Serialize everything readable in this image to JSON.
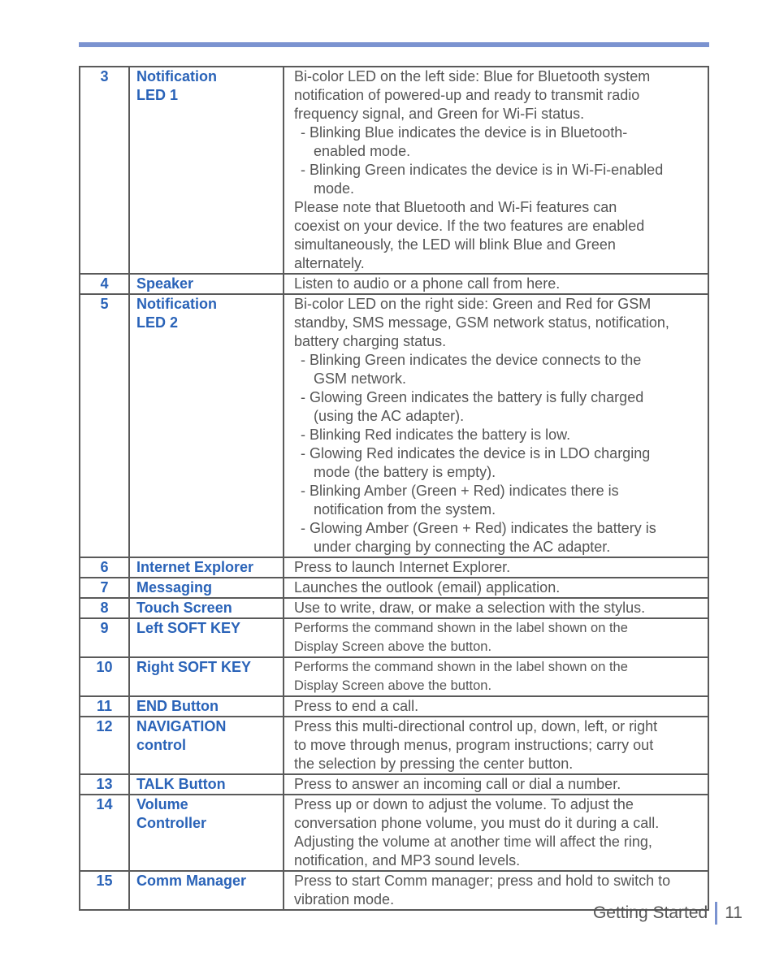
{
  "colors": {
    "accent_bar": "#7b93d0",
    "item_label": "#2a63b8",
    "body_text": "#555555",
    "border": "#5a5a5a"
  },
  "rows": [
    {
      "num": "3",
      "name": [
        "Notification",
        "LED 1"
      ],
      "desc": [
        {
          "t": "line",
          "text": "Bi-color LED on the left side: Blue for Bluetooth system"
        },
        {
          "t": "line",
          "text": "notification of powered-up and ready to transmit radio"
        },
        {
          "t": "line",
          "text": "frequency signal, and Green for Wi-Fi status."
        },
        {
          "t": "bullet",
          "text": "- Blinking Blue indicates the device is in Bluetooth-"
        },
        {
          "t": "cont",
          "text": "enabled mode."
        },
        {
          "t": "bullet",
          "text": "- Blinking Green indicates the device is in Wi-Fi-enabled"
        },
        {
          "t": "cont",
          "text": "mode."
        },
        {
          "t": "line",
          "text": "Please note that Bluetooth and Wi-Fi features can"
        },
        {
          "t": "line",
          "text": "coexist on your device. If the two features are enabled"
        },
        {
          "t": "line",
          "text": "simultaneously, the LED will blink Blue and Green"
        },
        {
          "t": "line",
          "text": "alternately."
        }
      ]
    },
    {
      "num": "4",
      "name": [
        "Speaker"
      ],
      "desc": [
        {
          "t": "line",
          "text": "Listen to audio or a phone call from here."
        }
      ]
    },
    {
      "num": "5",
      "name": [
        "Notification",
        "LED 2"
      ],
      "desc": [
        {
          "t": "line",
          "text": "Bi-color LED on the right side: Green and Red for GSM"
        },
        {
          "t": "line",
          "text": "standby, SMS message, GSM network status, notification,"
        },
        {
          "t": "line",
          "text": "battery charging status."
        },
        {
          "t": "bullet",
          "text": "-  Blinking Green indicates the device connects to the"
        },
        {
          "t": "cont",
          "text": "GSM network."
        },
        {
          "t": "bullet",
          "text": "-  Glowing Green indicates the battery is fully charged"
        },
        {
          "t": "cont",
          "text": "(using the AC adapter)."
        },
        {
          "t": "bullet",
          "text": "-  Blinking Red indicates the battery is low."
        },
        {
          "t": "bullet",
          "text": "-  Glowing Red indicates the device is in LDO charging"
        },
        {
          "t": "cont",
          "text": "mode (the battery is empty)."
        },
        {
          "t": "bullet",
          "text": "-  Blinking Amber (Green + Red) indicates there is"
        },
        {
          "t": "cont",
          "text": "notification from the system."
        },
        {
          "t": "bullet",
          "text": "-  Glowing Amber (Green + Red) indicates the battery is"
        },
        {
          "t": "cont",
          "text": "under charging by connecting the AC adapter."
        }
      ]
    },
    {
      "num": "6",
      "name": [
        "Internet Explorer"
      ],
      "desc": [
        {
          "t": "line",
          "text": "Press to launch Internet Explorer."
        }
      ]
    },
    {
      "num": "7",
      "name": [
        "Messaging"
      ],
      "desc": [
        {
          "t": "line",
          "text": "Launches the outlook (email) application."
        }
      ]
    },
    {
      "num": "8",
      "name": [
        "Touch Screen"
      ],
      "desc": [
        {
          "t": "line",
          "text": "Use to write, draw, or make a selection with the stylus."
        }
      ]
    },
    {
      "num": "9",
      "name": [
        "Left SOFT KEY"
      ],
      "small": true,
      "desc": [
        {
          "t": "line",
          "text": "Performs the command shown in the label shown on the"
        },
        {
          "t": "line",
          "text": "Display Screen above the button."
        }
      ]
    },
    {
      "num": "10",
      "name": [
        "Right SOFT KEY"
      ],
      "small": true,
      "desc": [
        {
          "t": "line",
          "text": "Performs the command shown in the label shown on the"
        },
        {
          "t": "line",
          "text": "Display Screen above the button."
        }
      ]
    },
    {
      "num": "11",
      "name": [
        "END Button"
      ],
      "desc": [
        {
          "t": "line",
          "text": "Press to end a call."
        }
      ]
    },
    {
      "num": "12",
      "name": [
        "NAVIGATION",
        "control"
      ],
      "desc": [
        {
          "t": "line",
          "text": "Press this multi-directional control up, down, left, or right"
        },
        {
          "t": "line",
          "text": "to move through menus, program instructions; carry out"
        },
        {
          "t": "line",
          "text": "the selection by pressing the center button."
        }
      ]
    },
    {
      "num": "13",
      "name": [
        "TALK Button"
      ],
      "desc": [
        {
          "t": "line",
          "text": "Press to answer an incoming call or dial a number."
        }
      ]
    },
    {
      "num": "14",
      "name": [
        "Volume",
        "Controller"
      ],
      "desc": [
        {
          "t": "line",
          "text": "Press up or down to adjust the volume. To adjust the"
        },
        {
          "t": "line",
          "text": "conversation phone volume, you must do it during a call."
        },
        {
          "t": "line",
          "text": "Adjusting the volume at another time will affect the ring,"
        },
        {
          "t": "line",
          "text": "notification, and MP3 sound levels."
        }
      ]
    },
    {
      "num": "15",
      "name": [
        "Comm Manager"
      ],
      "desc": [
        {
          "t": "line",
          "text": "Press to start Comm manager; press and hold to switch to"
        },
        {
          "t": "line",
          "text": "vibration mode."
        }
      ]
    }
  ],
  "footer": {
    "section": "Getting Started",
    "page": "11"
  }
}
